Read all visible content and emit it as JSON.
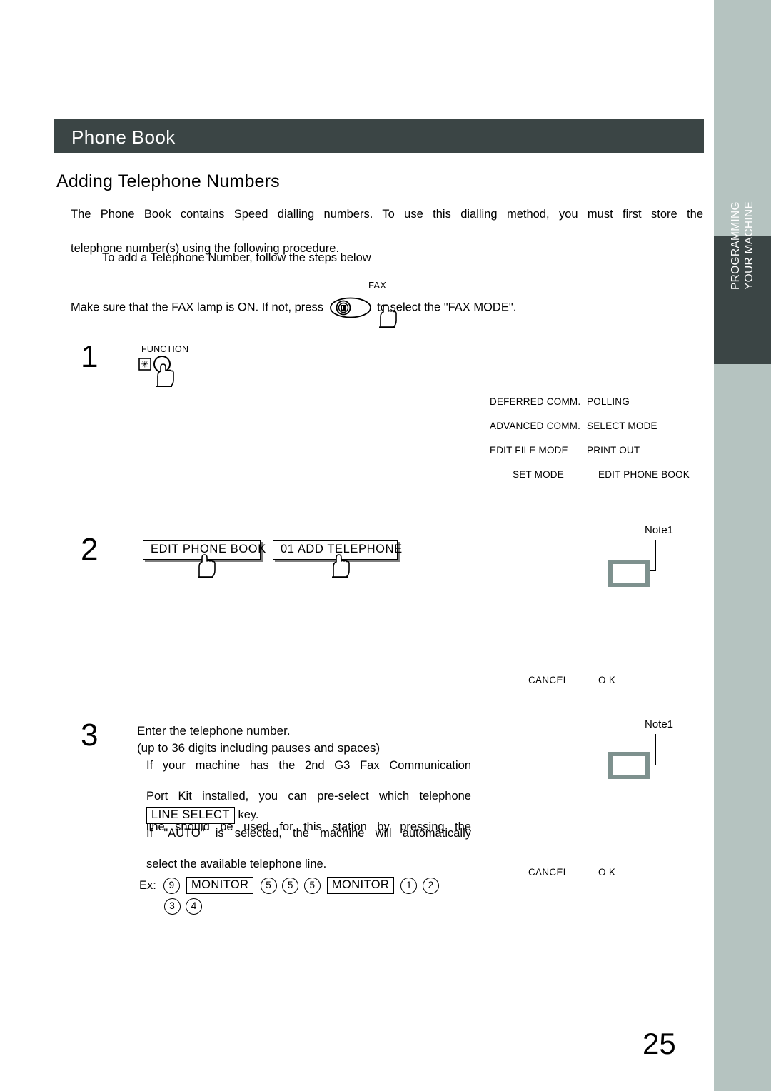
{
  "chapter": {
    "title": "Phone Book"
  },
  "section": {
    "title": "Adding Telephone Numbers"
  },
  "intro": {
    "line1": "The  Phone  Book  contains  Speed  dialling  numbers.  To  use  this  dialling  method,  you  must  first  store  the",
    "line2": "telephone number(s) using the following procedure.",
    "sub": "To add a Telephone Number, follow the steps below",
    "fax_prefix": "Make sure that the FAX lamp is ON.  If not, press",
    "fax_suffix": "to select the \"FAX MODE\".",
    "fax_key_label": "FAX"
  },
  "steps": {
    "one": {
      "number": "1",
      "key_label": "FUNCTION"
    },
    "two": {
      "number": "2",
      "key1": "EDIT PHONE BOOK",
      "key2": "01  ADD TELEPHONE"
    },
    "three": {
      "number": "3",
      "line1": "Enter the telephone number.",
      "line2": "(up to 36 digits including pauses and spaces)",
      "body_l1": "If  your  machine  has  the  2nd  G3  Fax  Communication",
      "body_l2": "Port  Kit  installed,  you  can  pre-select  which  telephone",
      "body_l3": "line  should  be  used  for  this  station  by  pressing  the",
      "line_select_key": "LINE SELECT",
      "line_select_tail": "key.",
      "body_l4": "If  \"AUTO\"  is  selected,  the  machine  will  automatically",
      "body_l5": "select the available telephone line.",
      "example_label": "Ex:",
      "example_keys_row1": [
        "9",
        "MONITOR",
        "5",
        "5",
        "5",
        "MONITOR",
        "1",
        "2"
      ],
      "example_keys_row2": [
        "3",
        "4"
      ]
    }
  },
  "menu_map": {
    "rows": [
      {
        "left": "DEFERRED COMM.",
        "right": "POLLING",
        "centered": false
      },
      {
        "left": "ADVANCED COMM.",
        "right": "SELECT MODE",
        "centered": false
      },
      {
        "left": "EDIT FILE MODE",
        "right": "PRINT OUT",
        "centered": false
      },
      {
        "left": "SET MODE",
        "right": "EDIT PHONE BOOK",
        "centered": true
      }
    ]
  },
  "callouts": {
    "note_label_1": "Note1",
    "note_label_2": "Note1"
  },
  "softkeys": {
    "cancel": "CANCEL",
    "ok": "O K"
  },
  "sidebar": {
    "tab_text": "PROGRAMMING\nYOUR MACHINE"
  },
  "footer": {
    "page_number": "25"
  },
  "colors": {
    "header_bar": "#3b4545",
    "side_rail": "#b5c3c0",
    "lcd_border": "#7e918e",
    "key_shadow": "#7d7d7d"
  }
}
